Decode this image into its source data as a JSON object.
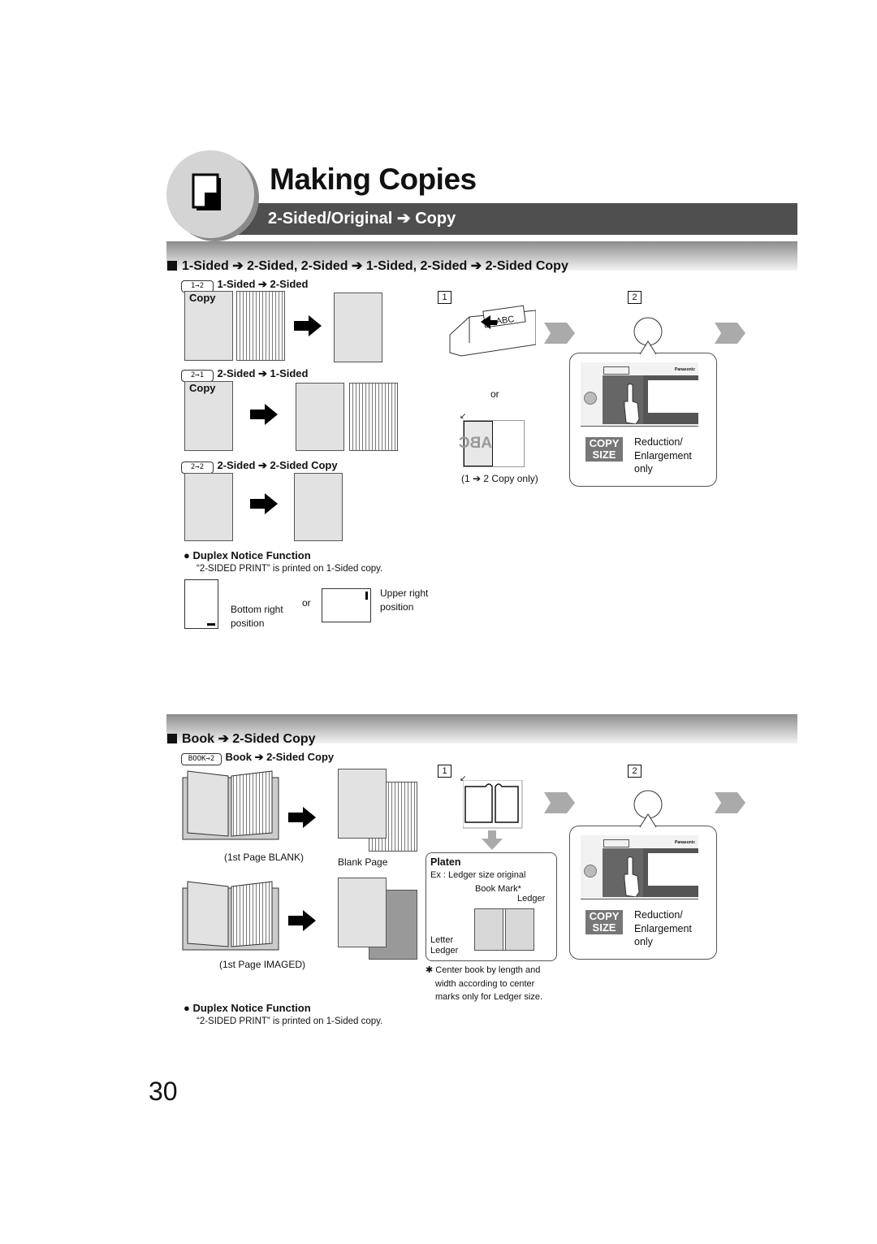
{
  "header": {
    "title": "Making Copies",
    "subtitle": "2-Sided/Original ➔ Copy",
    "icon": "copy-document-icon"
  },
  "section1": {
    "title": "1-Sided ➔ 2-Sided, 2-Sided ➔ 1-Sided, 2-Sided ➔ 2-Sided Copy",
    "modes": [
      {
        "key": "1→2",
        "label": "1-Sided  ➔  2-Sided",
        "copy_label": "Copy"
      },
      {
        "key": "2→1",
        "label": "2-Sided ➔ 1-Sided",
        "copy_label": "Copy"
      },
      {
        "key": "2→2",
        "label": "2-Sided ➔ 2-Sided Copy"
      }
    ],
    "duplex": {
      "title": "Duplex Notice Function",
      "desc": "“2-SIDED PRINT” is printed on 1-Sided copy.",
      "bottom_right": "Bottom right",
      "position": "position",
      "or": "or",
      "upper_right": "Upper right",
      "position2": "position"
    },
    "step1": {
      "num": "1",
      "adf_text": "ABC",
      "or": "or",
      "platen_text": "ABC",
      "note": "(1 ➔ 2 Copy only)"
    },
    "step2": {
      "num": "2",
      "brand": "Panasonic",
      "copy_size": [
        "COPY",
        "SIZE"
      ],
      "desc": [
        "Reduction/",
        "Enlargement",
        "only"
      ]
    }
  },
  "section2": {
    "title": "Book ➔ 2-Sided Copy",
    "mode": {
      "key": "BOOK→2",
      "label": "Book ➔ 2-Sided Copy"
    },
    "captions": {
      "blank": "(1st Page BLANK)",
      "blank_page": "Blank Page",
      "imaged": "(1st Page IMAGED)"
    },
    "duplex": {
      "title": "Duplex Notice Function",
      "desc": "“2-SIDED PRINT” is printed on 1-Sided copy."
    },
    "step1": {
      "num": "1",
      "platen": {
        "title": "Platen",
        "example": "Ex : Ledger size original",
        "book_mark": "Book Mark*",
        "ledger": "Ledger",
        "letter": "Letter",
        "ledger2": "Ledger"
      },
      "footnote": [
        "✱ Center book by length and",
        "width according to center",
        "marks only for Ledger size."
      ]
    },
    "step2": {
      "num": "2",
      "brand": "Panasonic",
      "copy_size": [
        "COPY",
        "SIZE"
      ],
      "desc": [
        "Reduction/",
        "Enlargement",
        "only"
      ]
    }
  },
  "page_number": "30"
}
